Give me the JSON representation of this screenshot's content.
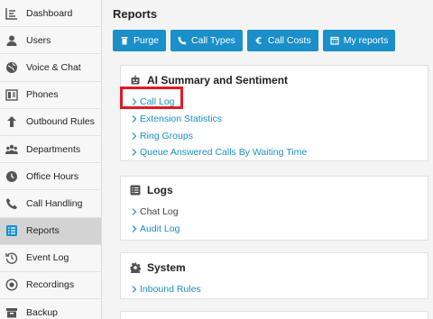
{
  "sidebar": {
    "items": [
      {
        "label": "Dashboard",
        "icon": "dashboard-icon",
        "active": false
      },
      {
        "label": "Users",
        "icon": "user-icon",
        "active": false
      },
      {
        "label": "Voice & Chat",
        "icon": "globe-icon",
        "active": false
      },
      {
        "label": "Phones",
        "icon": "phones-icon",
        "active": false
      },
      {
        "label": "Outbound Rules",
        "icon": "arrow-up-icon",
        "active": false
      },
      {
        "label": "Departments",
        "icon": "group-icon",
        "active": false
      },
      {
        "label": "Office Hours",
        "icon": "clock-icon",
        "active": false
      },
      {
        "label": "Call Handling",
        "icon": "phone-handset-icon",
        "active": false
      },
      {
        "label": "Reports",
        "icon": "list-icon",
        "active": true
      },
      {
        "label": "Event Log",
        "icon": "history-icon",
        "active": false
      },
      {
        "label": "Recordings",
        "icon": "record-icon",
        "active": false
      },
      {
        "label": "Backup",
        "icon": "archive-icon",
        "active": false
      }
    ]
  },
  "main": {
    "title": "Reports",
    "toolbar": {
      "purge": "Purge",
      "call_types": "Call Types",
      "call_costs": "Call Costs",
      "my_reports": "My reports"
    },
    "sections": {
      "ai": {
        "title": "AI Summary and Sentiment",
        "links": [
          "Call Log",
          "Extension Statistics",
          "Ring Groups",
          "Queue Answered Calls By Waiting Time"
        ]
      },
      "logs": {
        "title": "Logs",
        "links": [
          "Chat Log",
          "Audit Log"
        ]
      },
      "system": {
        "title": "System",
        "links": [
          "Inbound Rules"
        ]
      }
    }
  },
  "colors": {
    "accent": "#1a8fc9",
    "highlight": "#e01b24",
    "active_nav": "#d3d3d3"
  }
}
